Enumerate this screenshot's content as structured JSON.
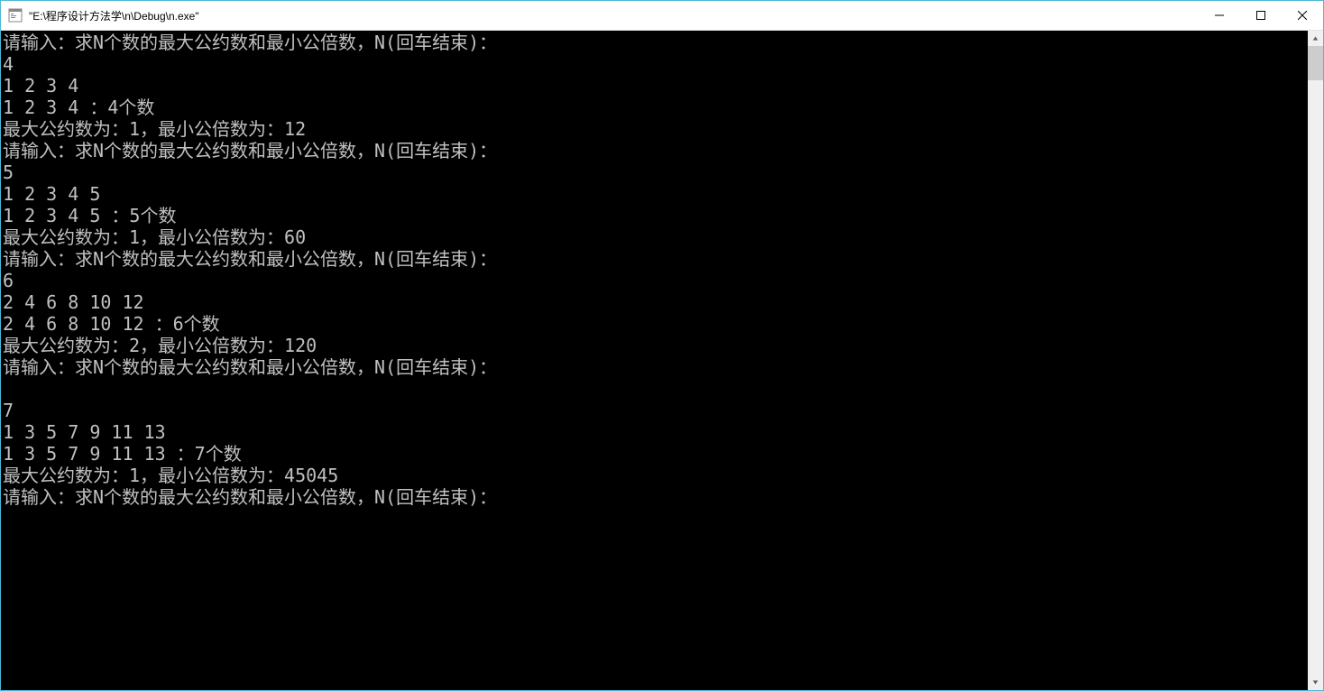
{
  "window": {
    "title": "\"E:\\程序设计方法学\\n\\Debug\\n.exe\""
  },
  "console": {
    "lines": [
      "请输入：求N个数的最大公约数和最小公倍数，N(回车结束)：",
      "4",
      "1 2 3 4",
      "1 2 3 4 ：4个数",
      "最大公约数为：1，最小公倍数为：12",
      "请输入：求N个数的最大公约数和最小公倍数，N(回车结束)：",
      "5",
      "1 2 3 4 5",
      "1 2 3 4 5 ：5个数",
      "最大公约数为：1，最小公倍数为：60",
      "请输入：求N个数的最大公约数和最小公倍数，N(回车结束)：",
      "6",
      "2 4 6 8 10 12",
      "2 4 6 8 10 12 ：6个数",
      "最大公约数为：2，最小公倍数为：120",
      "请输入：求N个数的最大公约数和最小公倍数，N(回车结束)：",
      "",
      "7",
      "1 3 5 7 9 11 13",
      "1 3 5 7 9 11 13 ：7个数",
      "最大公约数为：1，最小公倍数为：45045",
      "请输入：求N个数的最大公约数和最小公倍数，N(回车结束)："
    ]
  }
}
